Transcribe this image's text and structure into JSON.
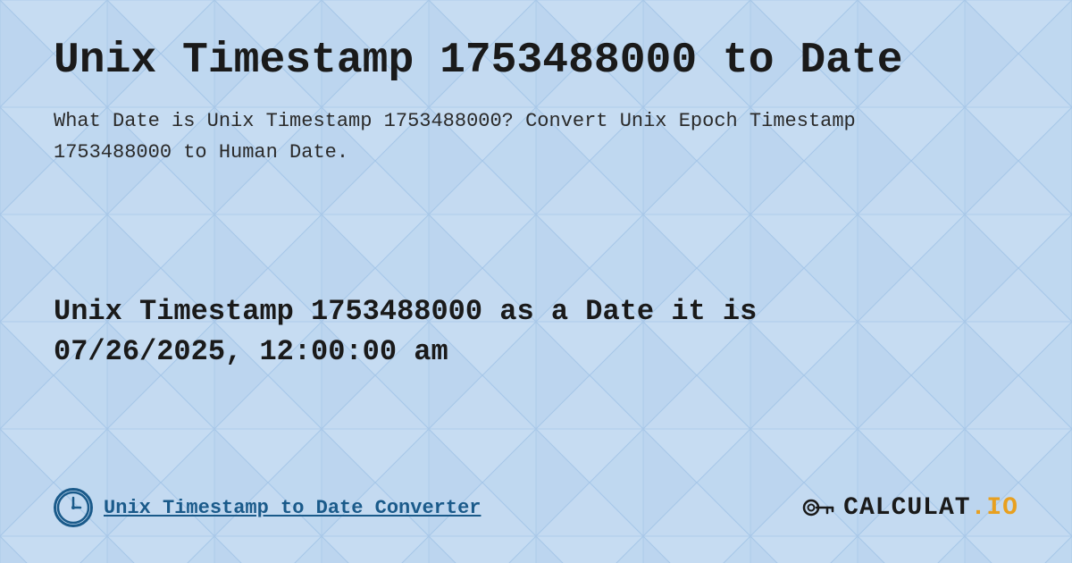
{
  "page": {
    "title": "Unix Timestamp 1753488000 to Date",
    "description": "What Date is Unix Timestamp 1753488000? Convert Unix Epoch Timestamp 1753488000 to Human Date.",
    "result_line1": "Unix Timestamp 1753488000 as a Date it is",
    "result_line2": "07/26/2025, 12:00:00 am",
    "footer_link": "Unix Timestamp to Date Converter",
    "logo_text_main": "CALCULAT",
    "logo_text_accent": ".IO",
    "bg_color": "#c8daf0"
  }
}
